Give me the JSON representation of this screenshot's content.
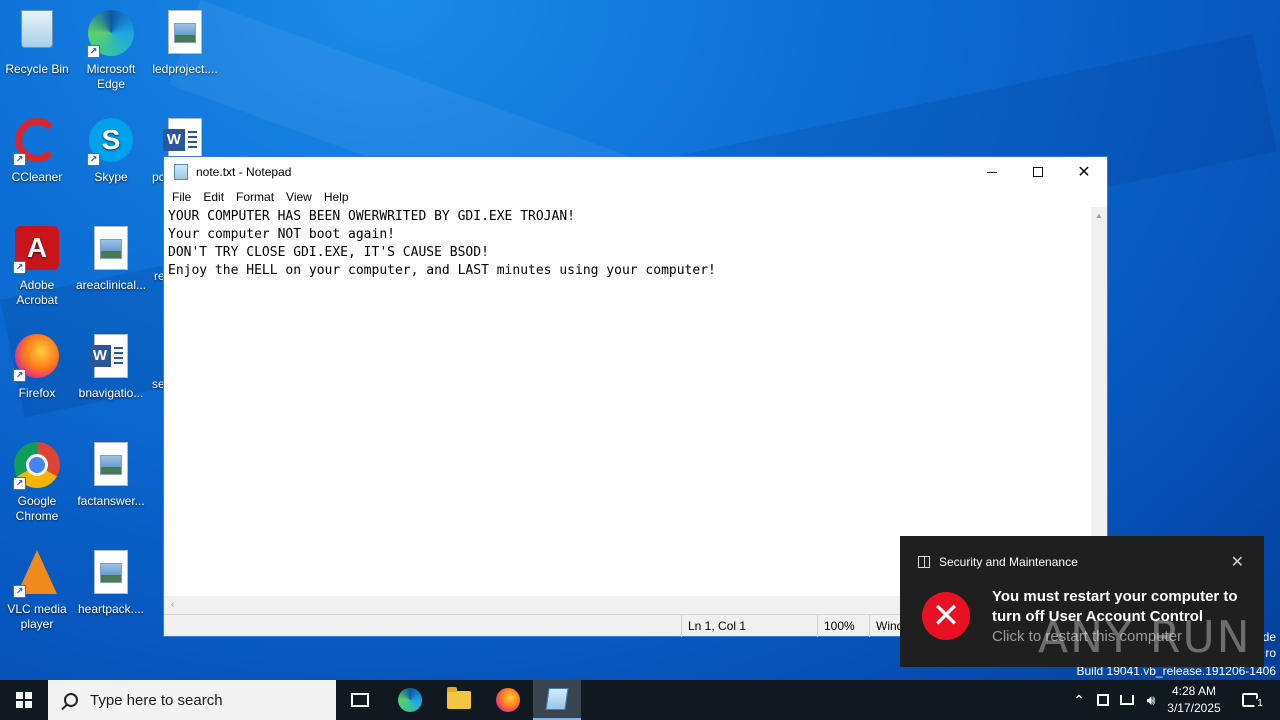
{
  "desktop": {
    "icons": [
      {
        "label": "Recycle Bin"
      },
      {
        "label": "Microsoft Edge"
      },
      {
        "label": "ledproject...."
      },
      {
        "label": "CCleaner"
      },
      {
        "label": "Skype"
      },
      {
        "label": "pc"
      },
      {
        "label": "Adobe Acrobat"
      },
      {
        "label": "areaclinical..."
      },
      {
        "label": "re"
      },
      {
        "label": "Firefox"
      },
      {
        "label": "bnavigatio..."
      },
      {
        "label": "se"
      },
      {
        "label": "Google Chrome"
      },
      {
        "label": "factanswer..."
      },
      {
        "label": "VLC media player"
      },
      {
        "label": "heartpack...."
      }
    ]
  },
  "notepad": {
    "title": "note.txt - Notepad",
    "menu": [
      "File",
      "Edit",
      "Format",
      "View",
      "Help"
    ],
    "content": "YOUR COMPUTER HAS BEEN OWERWRITED BY GDI.EXE TROJAN!\nYour computer NOT boot again!\nDON'T TRY CLOSE GDI.EXE, IT'S CAUSE BSOD!\nEnjoy the HELL on your computer, and LAST minutes using your computer!",
    "status": {
      "position": "Ln 1, Col 1",
      "zoom": "100%",
      "encoding_partial": "Wind"
    }
  },
  "toast": {
    "app": "Security and Maintenance",
    "message": "You must restart your computer to turn off User Account Control",
    "subtext": "Click to restart this computer",
    "close_glyph": "✕",
    "error_glyph": "✕"
  },
  "watermark": "ANY RUN",
  "desktop_text": {
    "edition_line1": "de",
    "edition_line2": "ro",
    "build": "Build 19041.vb_release.191206-1406"
  },
  "taskbar": {
    "search_placeholder": "Type here to search",
    "time": "4:28 AM",
    "date": "3/17/2025",
    "notification_count": "1"
  },
  "colors": {
    "accent": "#0078d7",
    "toast_bg": "#1f1f1f",
    "error_red": "#e81123",
    "taskbar_bg": "#101820"
  }
}
